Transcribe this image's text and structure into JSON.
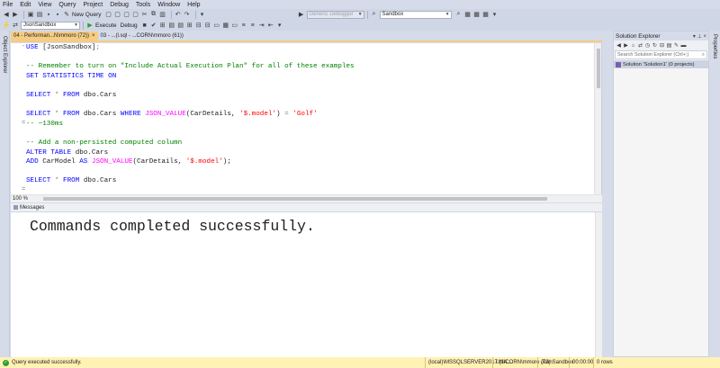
{
  "menu": [
    "File",
    "Edit",
    "View",
    "Query",
    "Project",
    "Debug",
    "Tools",
    "Window",
    "Help"
  ],
  "toolbar1": {
    "new_query_label": "New Query",
    "debugger_combo": "Generic Debugger",
    "solution_combo": "Sandbox"
  },
  "toolbar2": {
    "database_combo": "JsonSandbox",
    "execute_label": "Execute",
    "debug_label": "Debug"
  },
  "doc_tabs": [
    {
      "label": "04 - Performan...N\\mmoro (72))",
      "close": "×",
      "active": true
    },
    {
      "label": "03 - ...(l.sql - ...CORN\\mmoro (61))",
      "close": "",
      "active": false
    }
  ],
  "side_labels": {
    "left": "Object Explorer",
    "right": "Properties"
  },
  "editor": {
    "lines": [
      [
        {
          "t": "USE ",
          "c": "kw"
        },
        {
          "t": "[JsonSandbox]",
          "c": "id"
        },
        {
          "t": ";",
          "c": "gy"
        }
      ],
      [],
      [
        {
          "t": "-- Remember to turn on \"Include Actual Execution Plan\" for all of these examples",
          "c": "cm"
        }
      ],
      [
        {
          "t": "SET STATISTICS TIME ON",
          "c": "kw"
        }
      ],
      [],
      [
        {
          "t": "SELECT ",
          "c": "kw"
        },
        {
          "t": "* ",
          "c": "gy"
        },
        {
          "t": "FROM ",
          "c": "kw"
        },
        {
          "t": "dbo.Cars",
          "c": "id"
        }
      ],
      [],
      [
        {
          "t": "SELECT ",
          "c": "kw"
        },
        {
          "t": "* ",
          "c": "gy"
        },
        {
          "t": "FROM ",
          "c": "kw"
        },
        {
          "t": "dbo.Cars ",
          "c": "id"
        },
        {
          "t": "WHERE ",
          "c": "kw"
        },
        {
          "t": "JSON_VALUE",
          "c": "fn"
        },
        {
          "t": "(CarDetails, ",
          "c": "id"
        },
        {
          "t": "'$.model'",
          "c": "st"
        },
        {
          "t": ") ",
          "c": "id"
        },
        {
          "t": "= ",
          "c": "gy"
        },
        {
          "t": "'Golf'",
          "c": "st"
        }
      ],
      [
        {
          "t": "-- ~130ms",
          "c": "cm"
        }
      ],
      [],
      [
        {
          "t": "-- Add a non-persisted computed column",
          "c": "cm"
        }
      ],
      [
        {
          "t": "ALTER TABLE ",
          "c": "kw"
        },
        {
          "t": "dbo.Cars",
          "c": "id"
        }
      ],
      [
        {
          "t": "ADD ",
          "c": "kw"
        },
        {
          "t": "CarModel ",
          "c": "id"
        },
        {
          "t": "AS ",
          "c": "kw"
        },
        {
          "t": "JSON_VALUE",
          "c": "fn"
        },
        {
          "t": "(CarDetails, ",
          "c": "id"
        },
        {
          "t": "'$.model'",
          "c": "st"
        },
        {
          "t": ");",
          "c": "id"
        }
      ],
      [],
      [
        {
          "t": "SELECT ",
          "c": "kw"
        },
        {
          "t": "* ",
          "c": "gy"
        },
        {
          "t": "FROM ",
          "c": "kw"
        },
        {
          "t": "dbo.Cars",
          "c": "id"
        }
      ]
    ],
    "zoom": "100 %"
  },
  "messages": {
    "tab_label": "Messages",
    "text": "Commands completed successfully."
  },
  "solution_explorer": {
    "title": "Solution Explorer",
    "search_placeholder": "Search Solution Explorer (Ctrl+;)",
    "item": "Solution 'Solution1' (0 projects)"
  },
  "status": {
    "message": "Query executed successfully.",
    "server": "(local)\\MSSQLSERVER2017 (14....",
    "user": "UNICORN\\mmoro (73)",
    "database": "JsonSandbox",
    "time": "00:00:00",
    "rows": "0 rows"
  },
  "colors": {
    "accent": "#f5cc84",
    "status_bg": "#fff2b4",
    "keyword": "#0000ff",
    "comment": "#008000",
    "string": "#ff0000",
    "function": "#ff00ff"
  }
}
